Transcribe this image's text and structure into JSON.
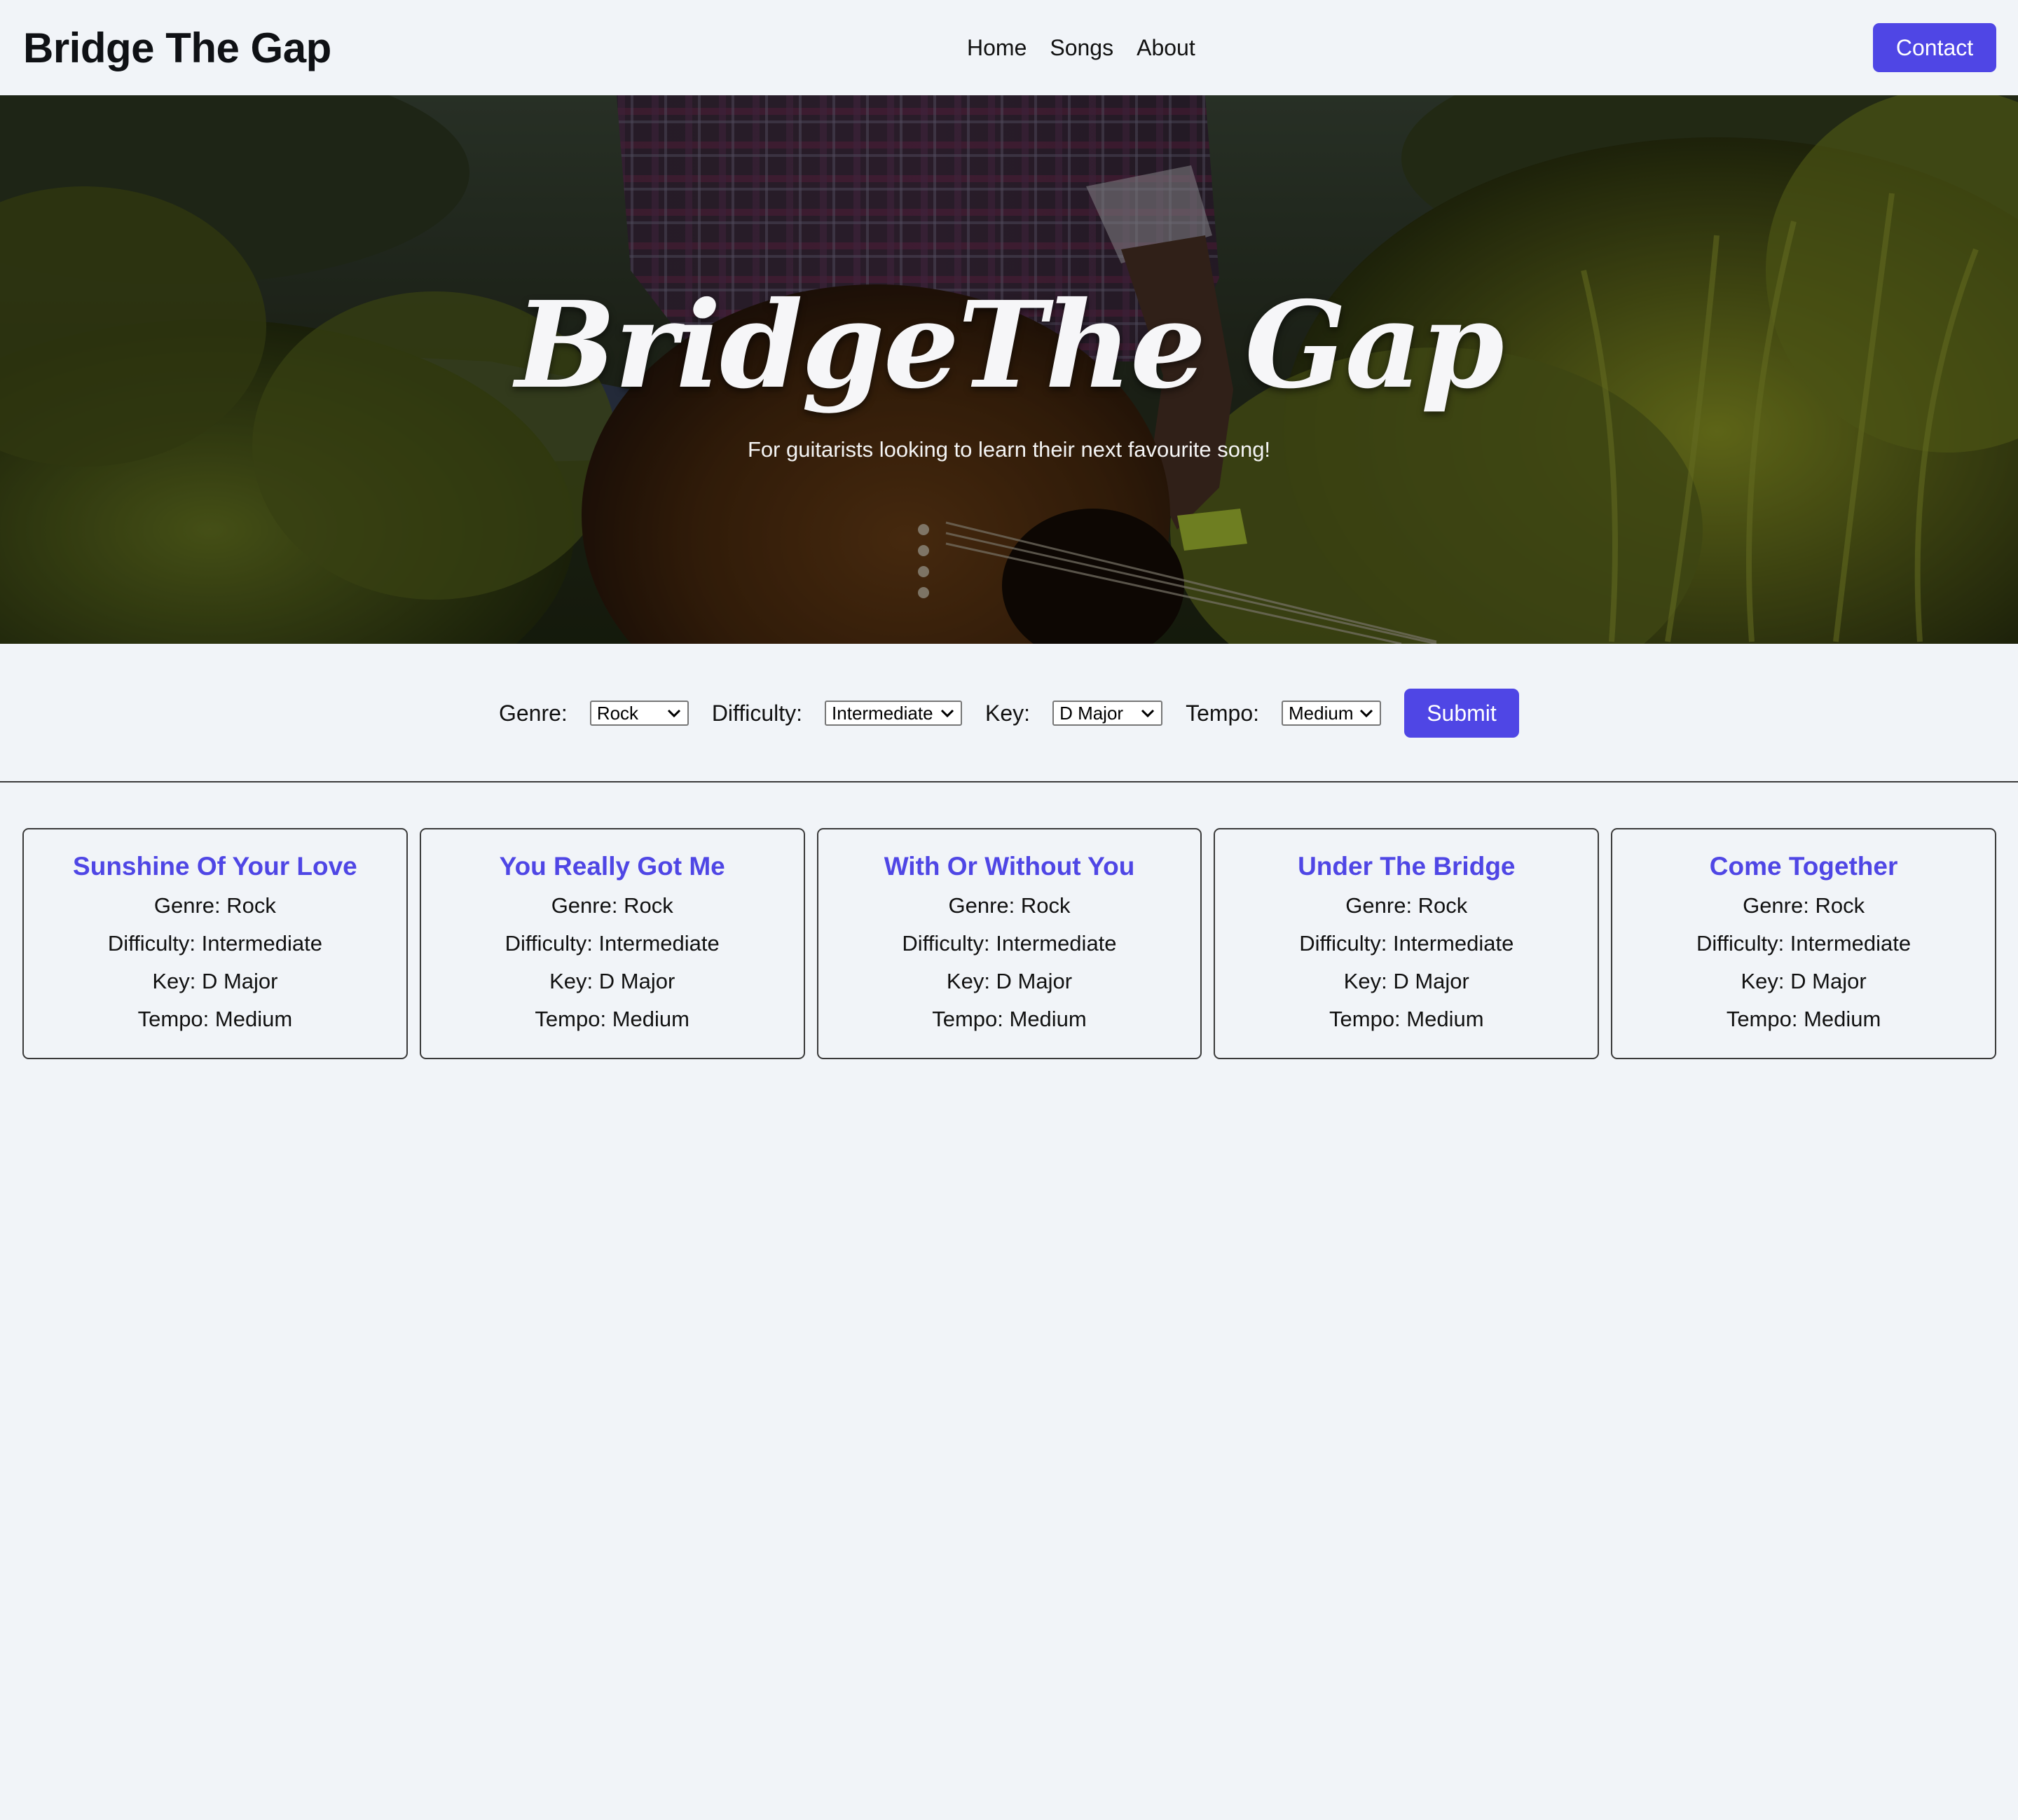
{
  "header": {
    "brand": "Bridge The Gap",
    "nav": [
      {
        "label": "Home"
      },
      {
        "label": "Songs"
      },
      {
        "label": "About"
      }
    ],
    "contact_label": "Contact"
  },
  "hero": {
    "title": "BridgeThe Gap",
    "subtitle": "For guitarists looking to learn their next favourite song!"
  },
  "filters": {
    "genre_label": "Genre:",
    "genre_value": "Rock",
    "difficulty_label": "Difficulty:",
    "difficulty_value": "Intermediate",
    "key_label": "Key:",
    "key_value": "D Major",
    "tempo_label": "Tempo:",
    "tempo_value": "Medium",
    "submit_label": "Submit"
  },
  "songs": [
    {
      "title": "Sunshine Of Your Love",
      "genre": "Genre: Rock",
      "difficulty": "Difficulty: Intermediate",
      "key": "Key: D Major",
      "tempo": "Tempo: Medium"
    },
    {
      "title": "You Really Got Me",
      "genre": "Genre: Rock",
      "difficulty": "Difficulty: Intermediate",
      "key": "Key: D Major",
      "tempo": "Tempo: Medium"
    },
    {
      "title": "With Or Without You",
      "genre": "Genre: Rock",
      "difficulty": "Difficulty: Intermediate",
      "key": "Key: D Major",
      "tempo": "Tempo: Medium"
    },
    {
      "title": "Under The Bridge",
      "genre": "Genre: Rock",
      "difficulty": "Difficulty: Intermediate",
      "key": "Key: D Major",
      "tempo": "Tempo: Medium"
    },
    {
      "title": "Come Together",
      "genre": "Genre: Rock",
      "difficulty": "Difficulty: Intermediate",
      "key": "Key: D Major",
      "tempo": "Tempo: Medium"
    }
  ],
  "colors": {
    "accent": "#4f46e5",
    "page_background": "#f1f4f8",
    "text": "#111111"
  },
  "icons": {
    "select_arrow": "chevron-down-icon"
  }
}
